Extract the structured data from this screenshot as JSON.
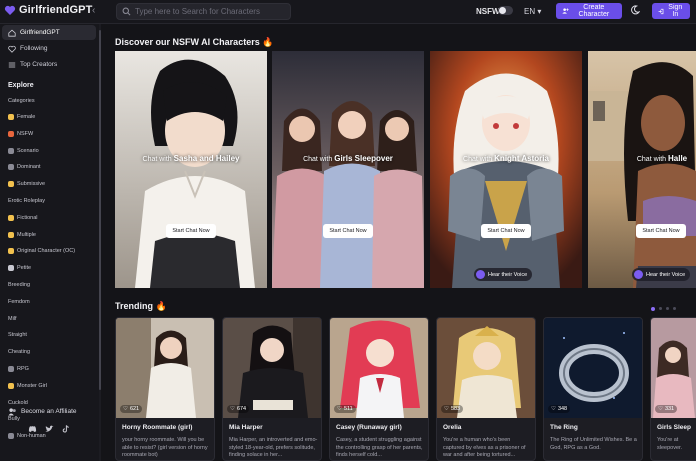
{
  "header": {
    "brand": "GirlfriendGPT",
    "search_placeholder": "Type here to Search for Characters",
    "nsfw_label": "NSFW",
    "language": "EN",
    "create_label": "Create Character",
    "signin_label": "Sign In"
  },
  "sidebar": {
    "nav": [
      {
        "label": "GirlfriendGPT",
        "icon": "home-icon"
      },
      {
        "label": "Following",
        "icon": "heart-icon"
      },
      {
        "label": "Top Creators",
        "icon": "list-icon"
      }
    ],
    "explore_label": "Explore",
    "categories_label": "Categories",
    "categories": [
      "Female",
      "NSFW",
      "Scenario",
      "Dominant",
      "Submissive",
      "Erotic Roleplay",
      "Fictional",
      "Multiple",
      "Original Character (OC)",
      "Petite",
      "Breeding",
      "Femdom",
      "Milf",
      "Straight",
      "Cheating",
      "RPG",
      "Monster Girl",
      "Cuckold",
      "Bully",
      "Non-human"
    ],
    "affiliate_label": "Become an Affiliate"
  },
  "hero": {
    "title": "Discover our NSFW AI Characters 🔥",
    "chat_with": "Chat with",
    "start_label": "Start Chat Now",
    "voice_label": "Hear their Voice",
    "slides": [
      {
        "name": "Sasha and Hailey"
      },
      {
        "name": "Girls Sleepover"
      },
      {
        "name": "Knight Astoria"
      },
      {
        "name": "Halle"
      }
    ]
  },
  "trending": {
    "title": "Trending 🔥",
    "cards": [
      {
        "likes": "621",
        "name": "Horny Roommate (girl)",
        "desc": "your horny roommate. Will you be able to resist? (girl version of horny roommate bot)"
      },
      {
        "likes": "674",
        "name": "Mia Harper",
        "desc": "Mia Harper, an introverted and emo-styled 18-year-old, prefers solitude, finding solace in her..."
      },
      {
        "likes": "511",
        "name": "Casey (Runaway girl)",
        "desc": "Casey, a student struggling against the controlling grasp of her parents, finds herself cold..."
      },
      {
        "likes": "583",
        "name": "Orelia",
        "desc": "You're a human who's been captured by elves as a prisoner of war and after being tortured..."
      },
      {
        "likes": "348",
        "name": "The Ring",
        "desc": "The Ring of Unlimited Wishes. Be a God, RPG as a God."
      },
      {
        "likes": "331",
        "name": "Girls Sleep",
        "desc": "You're at sleepover."
      }
    ]
  },
  "colors": {
    "accent": "#6a4ee9",
    "bg": "#141418",
    "sidebar": "#17171c"
  }
}
